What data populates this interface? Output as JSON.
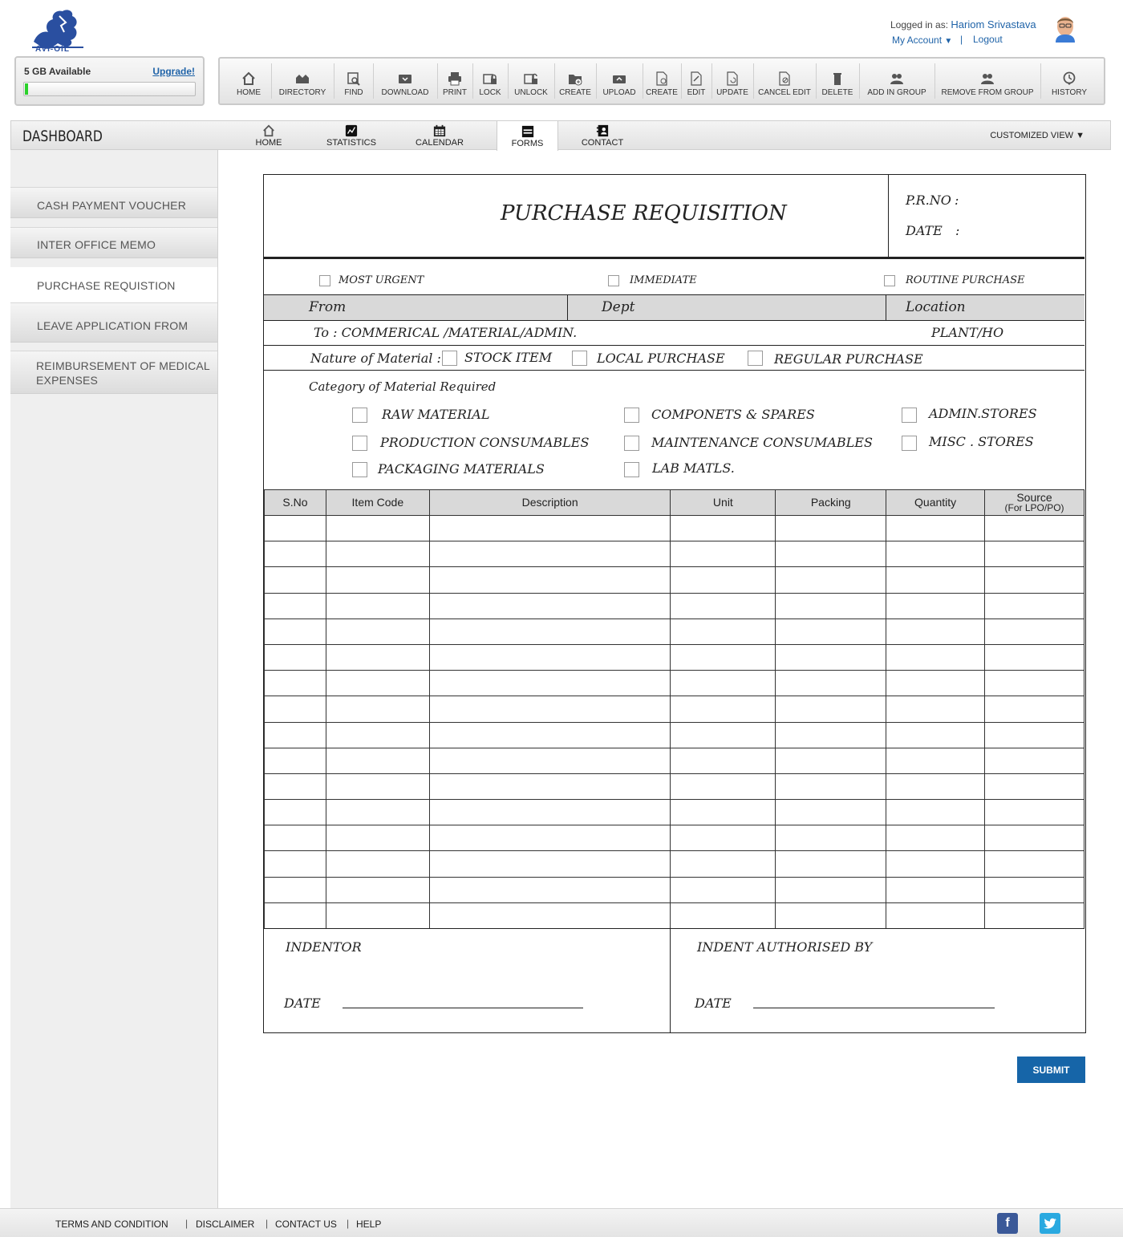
{
  "brand": {
    "logo_text": "AVI-OIL"
  },
  "storage": {
    "label": "5 GB Available",
    "upgrade": "Upgrade!",
    "used_fraction": 0.02
  },
  "user": {
    "prefix": "Logged in as:",
    "name": "Hariom Srivastava",
    "my_account": "My Account",
    "separator": "|",
    "logout": "Logout"
  },
  "toolbar": [
    {
      "label": "HOME",
      "icon": "home-icon"
    },
    {
      "label": "DIRECTORY",
      "icon": "directory-icon"
    },
    {
      "label": "FIND",
      "icon": "find-icon"
    },
    {
      "label": "DOWNLOAD",
      "icon": "download-icon"
    },
    {
      "label": "PRINT",
      "icon": "print-icon"
    },
    {
      "label": "LOCK",
      "icon": "lock-icon"
    },
    {
      "label": "UNLOCK",
      "icon": "unlock-icon"
    },
    {
      "label": "CREATE",
      "icon": "create-folder-icon"
    },
    {
      "label": "UPLOAD",
      "icon": "upload-icon"
    },
    {
      "label": "CREATE",
      "icon": "create-file-icon"
    },
    {
      "label": "EDIT",
      "icon": "edit-icon"
    },
    {
      "label": "UPDATE",
      "icon": "update-icon"
    },
    {
      "label": "CANCEL EDIT",
      "icon": "cancel-edit-icon"
    },
    {
      "label": "DELETE",
      "icon": "delete-icon"
    },
    {
      "label": "ADD IN GROUP",
      "icon": "add-group-icon"
    },
    {
      "label": "REMOVE FROM GROUP",
      "icon": "remove-group-icon"
    },
    {
      "label": "HISTORY",
      "icon": "history-icon"
    }
  ],
  "nav": {
    "title": "DASHBOARD",
    "tabs": [
      {
        "label": "HOME",
        "icon": "home-icon"
      },
      {
        "label": "STATISTICS",
        "icon": "statistics-icon"
      },
      {
        "label": "CALENDAR",
        "icon": "calendar-icon"
      },
      {
        "label": "FORMS",
        "icon": "forms-icon",
        "active": true
      },
      {
        "label": "CONTACT",
        "icon": "contact-icon"
      }
    ],
    "customized_view": "CUSTOMIZED VIEW ▼"
  },
  "sidebar": {
    "items": [
      {
        "label": "CASH PAYMENT VOUCHER"
      },
      {
        "label": "INTER OFFICE MEMO"
      },
      {
        "label": "PURCHASE REQUISTION",
        "active": true
      },
      {
        "label": "LEAVE APPLICATION FROM"
      },
      {
        "label": "REIMBURSEMENT OF MEDICAL",
        "label2": "EXPENSES"
      }
    ]
  },
  "form": {
    "title": "PURCHASE REQUISITION",
    "prno_label": "P.R.NO",
    "date_label": "DATE",
    "colon": ":",
    "priority": [
      "MOST URGENT",
      "IMMEDIATE",
      "ROUTINE PURCHASE"
    ],
    "from_label": "From",
    "dept_label": "Dept",
    "location_label": "Location",
    "to_text": "To : COMMERICAL /MATERIAL/ADMIN.",
    "plant_text": "PLANT/HO",
    "nature_label": "Nature of Material :",
    "nature_options": [
      "STOCK ITEM",
      "LOCAL PURCHASE",
      "REGULAR PURCHASE"
    ],
    "category_label": "Category of Material Required",
    "categories": [
      "RAW MATERIAL",
      "COMPONETS & SPARES",
      "ADMIN.STORES",
      "PRODUCTION CONSUMABLES",
      "MAINTENANCE CONSUMABLES",
      "MISC . STORES",
      "PACKAGING MATERIALS",
      "LAB MATLS."
    ],
    "table": {
      "headers": [
        "S.No",
        "Item Code",
        "Description",
        "Unit",
        "Packing",
        "Quantity",
        "Source"
      ],
      "source_sub": "(For LPO/PO)",
      "row_count": 16
    },
    "indentor_label": "INDENTOR",
    "authorised_label": "INDENT AUTHORISED BY",
    "sign_date_label": "DATE"
  },
  "submit_label": "SUBMIT",
  "footer": {
    "links": [
      "TERMS AND CONDITION",
      "DISCLAIMER",
      "CONTACT US",
      "HELP"
    ],
    "separator": "|",
    "social": [
      {
        "name": "facebook-icon",
        "color": "#3b5998"
      },
      {
        "name": "twitter-icon",
        "color": "#2aa9e0"
      }
    ]
  }
}
